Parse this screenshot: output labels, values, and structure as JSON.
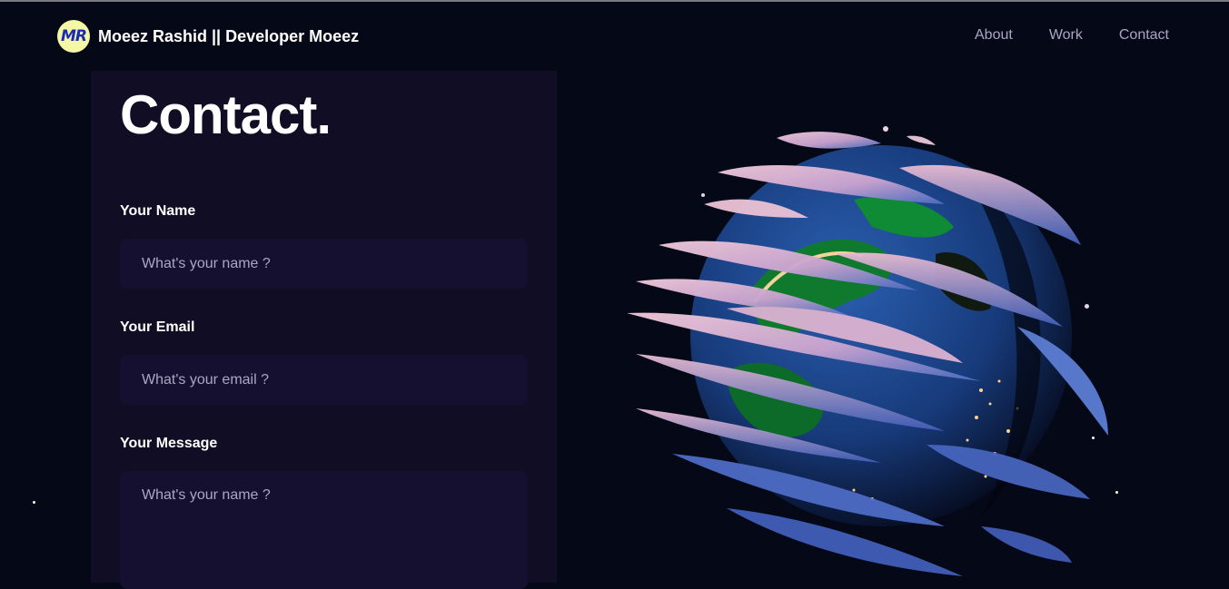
{
  "nav": {
    "logo_text": "MR",
    "brand": "Moeez Rashid || Developer Moeez",
    "links": [
      "About",
      "Work",
      "Contact"
    ]
  },
  "contact": {
    "title": "Contact.",
    "name_label": "Your Name",
    "name_placeholder": "What's your name ?",
    "email_label": "Your Email",
    "email_placeholder": "What's your email ?",
    "message_label": "Your Message",
    "message_placeholder": "What's your name ?"
  },
  "colors": {
    "background": "#050816",
    "card": "#100d25",
    "input": "#151030",
    "secondary_text": "#aaa6c3"
  },
  "canvas": {
    "subject": "earth-globe-icon"
  }
}
